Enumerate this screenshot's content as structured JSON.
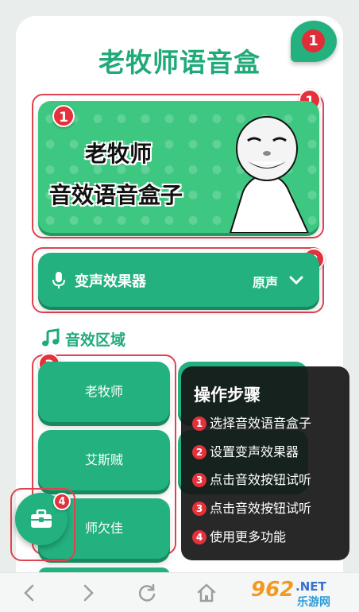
{
  "app": {
    "title": "老牧师语音盒"
  },
  "notification": {
    "count": "1"
  },
  "badges": {
    "banner": "1",
    "voice_changer": "2",
    "sound_area": "3",
    "toolbox": "4",
    "banner_inner": "1"
  },
  "banner": {
    "line1": "老牧师",
    "line2": "音效语音盒子",
    "image": "panda-meme-face"
  },
  "voice_changer": {
    "label": "变声效果器",
    "value": "原声",
    "icon": "microphone-icon"
  },
  "sound_area": {
    "title": "音效区域",
    "icon": "music-note-icon",
    "buttons": [
      "老牧师",
      "艾斯贼",
      "师欠佳"
    ]
  },
  "steps": {
    "title": "操作步骤",
    "items": [
      {
        "num": "1",
        "text": "选择音效语音盒子"
      },
      {
        "num": "2",
        "text": "设置变声效果器"
      },
      {
        "num": "3",
        "text": "点击音效按钮试听"
      },
      {
        "num": "3",
        "text": "点击音效按钮试听"
      },
      {
        "num": "4",
        "text": "使用更多功能"
      }
    ]
  },
  "watermark": {
    "num": "962",
    "tld": ".NET",
    "cn": "乐游网"
  },
  "colors": {
    "primary": "#23b27f",
    "title": "#1faa78",
    "badge": "#e4313b",
    "highlight": "#e04350",
    "banner": "#3dc780"
  }
}
